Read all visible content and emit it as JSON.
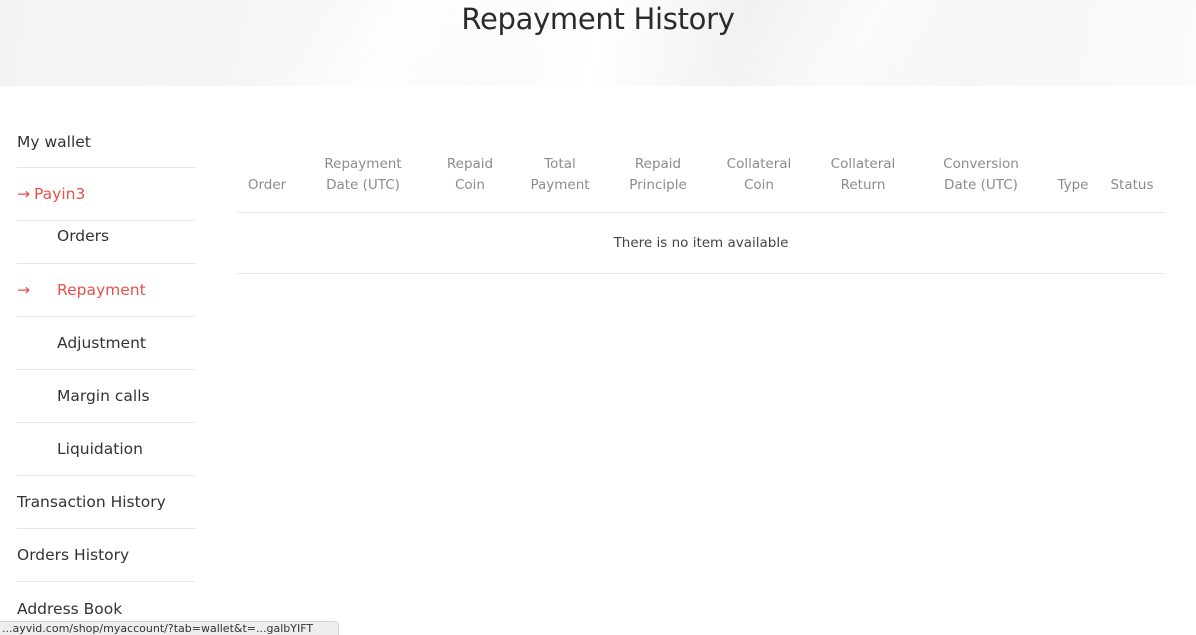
{
  "header": {
    "title": "Repayment History"
  },
  "sidebar": {
    "items": [
      {
        "label": "My wallet"
      },
      {
        "label": "Payin3",
        "arrow": "→"
      },
      {
        "label": "Orders"
      },
      {
        "label": "Repayment",
        "arrow": "→"
      },
      {
        "label": "Adjustment"
      },
      {
        "label": "Margin calls"
      },
      {
        "label": "Liquidation"
      },
      {
        "label": "Transaction History"
      },
      {
        "label": "Orders History"
      },
      {
        "label": "Address Book"
      }
    ]
  },
  "table": {
    "columns": [
      {
        "line1": "",
        "line2": "Order"
      },
      {
        "line1": "Repayment",
        "line2": "Date (UTC)"
      },
      {
        "line1": "Repaid",
        "line2": "Coin"
      },
      {
        "line1": "Total",
        "line2": "Payment"
      },
      {
        "line1": "Repaid",
        "line2": "Principle"
      },
      {
        "line1": "Collateral",
        "line2": "Coin"
      },
      {
        "line1": "Collateral",
        "line2": "Return"
      },
      {
        "line1": "Conversion",
        "line2": "Date (UTC)"
      },
      {
        "line1": "",
        "line2": "Type"
      },
      {
        "line1": "",
        "line2": "Status"
      }
    ],
    "empty_message": "There is no item available"
  },
  "status_bar": {
    "url": "...ayvid.com/shop/myaccount/?tab=wallet&t=...galbYIFT"
  },
  "colors": {
    "accent": "#e8504a",
    "text": "#333333",
    "header_text": "#8c8c8c",
    "divider": "#e6e6e6"
  }
}
